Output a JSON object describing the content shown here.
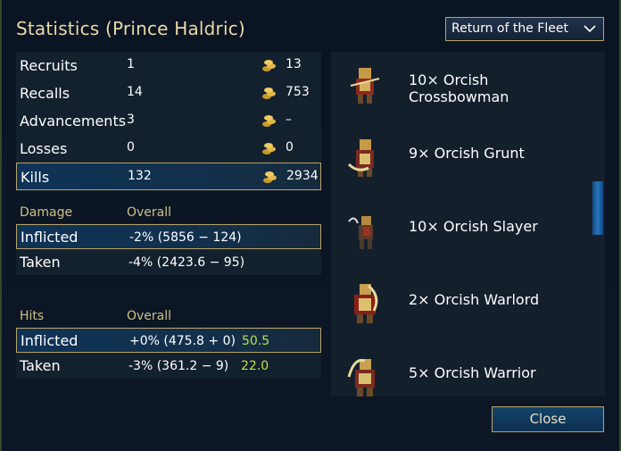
{
  "title": "Statistics (Prince Haldric)",
  "scenario_select": {
    "value": "Return of the Fleet",
    "icon": "chevron-down-icon"
  },
  "stats": [
    {
      "label": "Recruits",
      "value": "1",
      "gold": "13"
    },
    {
      "label": "Recalls",
      "value": "14",
      "gold": "753"
    },
    {
      "label": "Advancements",
      "value": "3",
      "gold": "–"
    },
    {
      "label": "Losses",
      "value": "0",
      "gold": "0"
    },
    {
      "label": "Kills",
      "value": "132",
      "gold": "2934"
    }
  ],
  "damage": {
    "head": "Damage",
    "col": "Overall",
    "rows": [
      {
        "label": "Inflicted",
        "value": "-2% (5856 − 124)"
      },
      {
        "label": "Taken",
        "value": "-4% (2423.6 − 95)"
      }
    ]
  },
  "hits": {
    "head": "Hits",
    "col": "Overall",
    "rows": [
      {
        "label": "Inflicted",
        "value": "+0% (475.8 + 0)",
        "extra": "50.5"
      },
      {
        "label": "Taken",
        "value": "-3% (361.2 − 9)",
        "extra": "22.0"
      }
    ]
  },
  "units": [
    {
      "name": "10× Orcish Crossbowman",
      "icon": "orcish-crossbowman-icon"
    },
    {
      "name": "9× Orcish Grunt",
      "icon": "orcish-grunt-icon"
    },
    {
      "name": "10× Orcish Slayer",
      "icon": "orcish-slayer-icon"
    },
    {
      "name": "2× Orcish Warlord",
      "icon": "orcish-warlord-icon"
    },
    {
      "name": "5× Orcish Warrior",
      "icon": "orcish-warrior-icon"
    }
  ],
  "close_label": "Close",
  "colors": {
    "accent_gold": "#b7a469",
    "highlight_green": "#b8e04a",
    "title": "#e8d9a8"
  }
}
